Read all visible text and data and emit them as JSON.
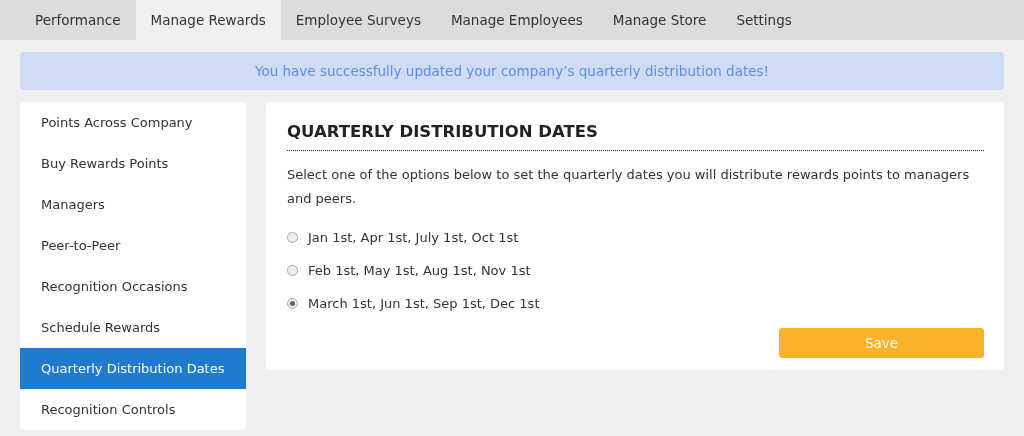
{
  "tabs": [
    {
      "label": "Performance",
      "selected": false
    },
    {
      "label": "Manage Rewards",
      "selected": true
    },
    {
      "label": "Employee Surveys",
      "selected": false
    },
    {
      "label": "Manage Employees",
      "selected": false
    },
    {
      "label": "Manage Store",
      "selected": false
    },
    {
      "label": "Settings",
      "selected": false
    }
  ],
  "alert": {
    "message": "You have successfully updated your company’s quarterly distribution dates!"
  },
  "sidebar": {
    "items": [
      {
        "label": "Points Across Company",
        "selected": false
      },
      {
        "label": "Buy Rewards Points",
        "selected": false
      },
      {
        "label": "Managers",
        "selected": false
      },
      {
        "label": "Peer-to-Peer",
        "selected": false
      },
      {
        "label": "Recognition Occasions",
        "selected": false
      },
      {
        "label": "Schedule Rewards",
        "selected": false
      },
      {
        "label": "Quarterly Distribution Dates",
        "selected": true
      },
      {
        "label": "Recognition Controls",
        "selected": false
      }
    ]
  },
  "panel": {
    "title": "QUARTERLY DISTRIBUTION DATES",
    "description": "Select one of the options below to set the quarterly dates you will distribute rewards points to managers and peers.",
    "options": [
      {
        "label": "Jan 1st, Apr 1st, July 1st, Oct 1st",
        "selected": false
      },
      {
        "label": "Feb 1st, May 1st, Aug 1st, Nov 1st",
        "selected": false
      },
      {
        "label": "March 1st, Jun 1st, Sep 1st, Dec 1st",
        "selected": true
      }
    ],
    "button": "Save"
  }
}
